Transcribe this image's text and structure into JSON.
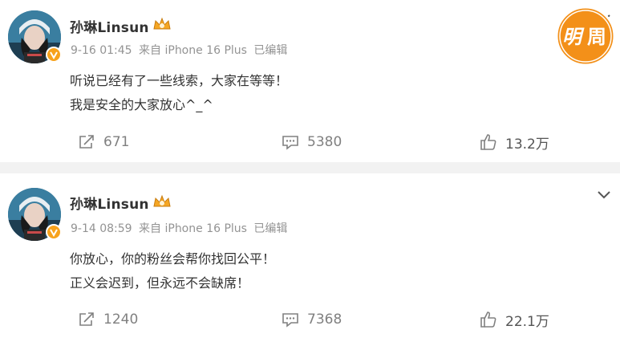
{
  "brand": {
    "logo_text_1": "明",
    "logo_text_2": "周",
    "logo_color": "#f39019"
  },
  "posts": [
    {
      "author": "孙琳Linsun",
      "date": "9-16 01:45",
      "source": "来自 iPhone 16 Plus",
      "edited": "已编辑",
      "lines": [
        "听说已经有了一些线索，大家在等等！",
        "我是安全的大家放心^_^"
      ],
      "reposts": "671",
      "comments": "5380",
      "likes": "13.2万"
    },
    {
      "author": "孙琳Linsun",
      "date": "9-14 08:59",
      "source": "来自 iPhone 16 Plus",
      "edited": "已编辑",
      "lines": [
        "你放心，你的粉丝会帮你找回公平！",
        "正义会迟到，但永远不会缺席！"
      ],
      "reposts": "1240",
      "comments": "7368",
      "likes": "22.1万"
    }
  ],
  "icons": {
    "repost": "share-icon",
    "comment": "comment-icon",
    "like": "thumbs-up-icon",
    "more": "chevron-down-icon",
    "verified": "verified-badge-icon",
    "member": "crown-icon"
  }
}
